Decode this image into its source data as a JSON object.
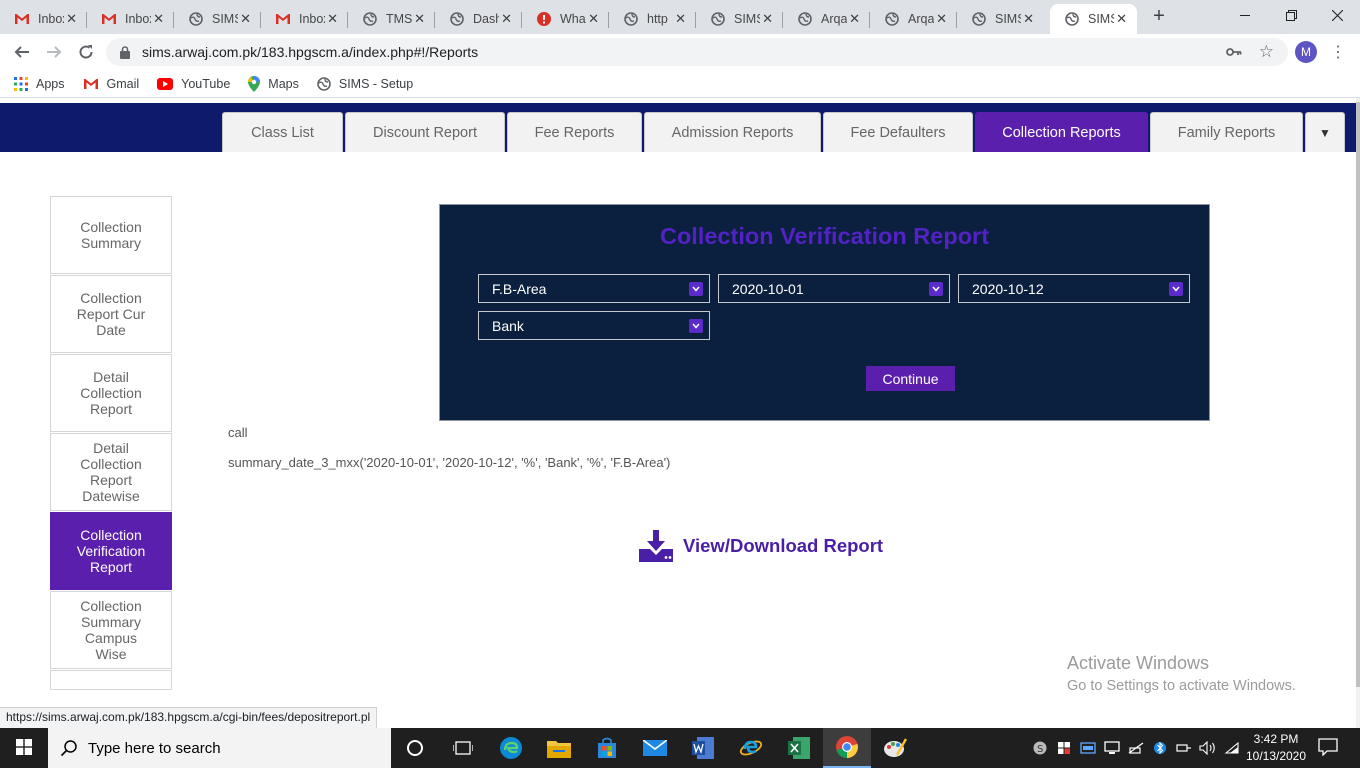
{
  "browser": {
    "tabs": [
      {
        "title": "Inbox",
        "icon": "gmail-icon",
        "active": false
      },
      {
        "title": "Inbox",
        "icon": "gmail-icon",
        "active": false
      },
      {
        "title": "SIMS",
        "icon": "globe-icon",
        "active": false
      },
      {
        "title": "Inbox",
        "icon": "gmail-icon",
        "active": false
      },
      {
        "title": "TMS",
        "icon": "globe-icon",
        "active": false
      },
      {
        "title": "Dash",
        "icon": "globe-icon",
        "active": false
      },
      {
        "title": "What",
        "icon": "error-icon",
        "active": false
      },
      {
        "title": "http",
        "icon": "globe-icon",
        "active": false
      },
      {
        "title": "SIMS",
        "icon": "globe-icon",
        "active": false
      },
      {
        "title": "Arqa",
        "icon": "globe-icon",
        "active": false
      },
      {
        "title": "Arqa",
        "icon": "globe-icon",
        "active": false
      },
      {
        "title": "SIMS",
        "icon": "globe-icon",
        "active": false
      },
      {
        "title": "SIMS",
        "icon": "globe-icon",
        "active": true
      }
    ],
    "url": "sims.arwaj.com.pk/183.hpgscm.a/index.php#!/Reports",
    "profile_initial": "M",
    "bookmarks": [
      {
        "label": "Apps",
        "icon": "apps-grid-icon"
      },
      {
        "label": "Gmail",
        "icon": "gmail-icon"
      },
      {
        "label": "YouTube",
        "icon": "youtube-icon"
      },
      {
        "label": "Maps",
        "icon": "maps-pin-icon"
      },
      {
        "label": "SIMS - Setup",
        "icon": "globe-icon"
      }
    ],
    "status_url": "https://sims.arwaj.com.pk/183.hpgscm.a/cgi-bin/fees/depositreport.pl"
  },
  "report_tabs": [
    {
      "label": "Class List",
      "active": false
    },
    {
      "label": "Discount Report",
      "active": false
    },
    {
      "label": "Fee Reports",
      "active": false
    },
    {
      "label": "Admission Reports",
      "active": false
    },
    {
      "label": "Fee Defaulters",
      "active": false
    },
    {
      "label": "Collection Reports",
      "active": true
    },
    {
      "label": "Family Reports",
      "active": false
    }
  ],
  "side_menu": [
    {
      "label": "Collection Summary",
      "active": false
    },
    {
      "label": "Collection Report Cur Date",
      "active": false
    },
    {
      "label": "Detail Collection Report",
      "active": false
    },
    {
      "label": "Detail Collection Report Datewise",
      "active": false
    },
    {
      "label": "Collection Verification Report",
      "active": true
    },
    {
      "label": "Collection Summary Campus Wise",
      "active": false
    }
  ],
  "form": {
    "title": "Collection Verification Report",
    "campus": "F.B-Area",
    "date_from": "2020-10-01",
    "date_to": "2020-10-12",
    "payment_mode": "Bank",
    "continue_label": "Continue"
  },
  "output": {
    "call_text": "call",
    "sql_text": "summary_date_3_mxx('2020-10-01', '2020-10-12', '%', 'Bank', '%', 'F.B-Area')",
    "download_label": "View/Download Report"
  },
  "watermark": {
    "line1": "Activate Windows",
    "line2": "Go to Settings to activate Windows."
  },
  "taskbar": {
    "search_placeholder": "Type here to search",
    "time": "3:42 PM",
    "date": "10/13/2020"
  },
  "colors": {
    "accent_purple": "#5b1fae",
    "nav_band": "#0e1a6b",
    "form_bg": "#0b1f3f",
    "title_purple": "#5222c4"
  }
}
